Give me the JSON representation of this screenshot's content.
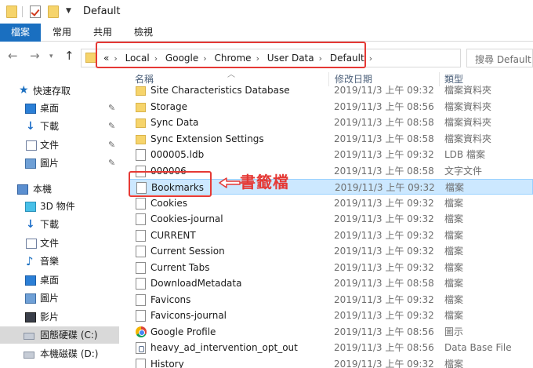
{
  "window": {
    "title": "Default"
  },
  "ribbon": {
    "tabs": [
      "檔案",
      "常用",
      "共用",
      "檢視"
    ]
  },
  "address": {
    "overflow": "«",
    "crumbs": [
      "Local",
      "Google",
      "Chrome",
      "User Data",
      "Default"
    ],
    "search_placeholder": "搜尋 Default"
  },
  "columns": {
    "name": "名稱",
    "date": "修改日期",
    "type": "類型"
  },
  "nav": {
    "quick_access": "快速存取",
    "quick_items": [
      "桌面",
      "下載",
      "文件",
      "圖片"
    ],
    "this_pc": "本機",
    "pc_items": [
      "3D 物件",
      "下載",
      "文件",
      "音樂",
      "桌面",
      "圖片",
      "影片",
      "固態硬碟 (C:)",
      "本機磁碟 (D:)"
    ]
  },
  "files": [
    {
      "name": "Site Characteristics Database",
      "date": "2019/11/3 上午 09:32",
      "type": "檔案資料夾",
      "icon": "folder"
    },
    {
      "name": "Storage",
      "date": "2019/11/3 上午 08:56",
      "type": "檔案資料夾",
      "icon": "folder"
    },
    {
      "name": "Sync Data",
      "date": "2019/11/3 上午 08:58",
      "type": "檔案資料夾",
      "icon": "folder"
    },
    {
      "name": "Sync Extension Settings",
      "date": "2019/11/3 上午 08:58",
      "type": "檔案資料夾",
      "icon": "folder"
    },
    {
      "name": "000005.ldb",
      "date": "2019/11/3 上午 09:32",
      "type": "LDB 檔案",
      "icon": "file"
    },
    {
      "name": "000006",
      "date": "2019/11/3 上午 08:58",
      "type": "文字文件",
      "icon": "file"
    },
    {
      "name": "Bookmarks",
      "date": "2019/11/3 上午 09:32",
      "type": "檔案",
      "icon": "file",
      "selected": true
    },
    {
      "name": "Cookies",
      "date": "2019/11/3 上午 09:32",
      "type": "檔案",
      "icon": "file"
    },
    {
      "name": "Cookies-journal",
      "date": "2019/11/3 上午 09:32",
      "type": "檔案",
      "icon": "file"
    },
    {
      "name": "CURRENT",
      "date": "2019/11/3 上午 09:32",
      "type": "檔案",
      "icon": "file"
    },
    {
      "name": "Current Session",
      "date": "2019/11/3 上午 09:32",
      "type": "檔案",
      "icon": "file"
    },
    {
      "name": "Current Tabs",
      "date": "2019/11/3 上午 09:32",
      "type": "檔案",
      "icon": "file"
    },
    {
      "name": "DownloadMetadata",
      "date": "2019/11/3 上午 08:58",
      "type": "檔案",
      "icon": "file"
    },
    {
      "name": "Favicons",
      "date": "2019/11/3 上午 09:32",
      "type": "檔案",
      "icon": "file"
    },
    {
      "name": "Favicons-journal",
      "date": "2019/11/3 上午 09:32",
      "type": "檔案",
      "icon": "file"
    },
    {
      "name": "Google Profile",
      "date": "2019/11/3 上午 08:56",
      "type": "圖示",
      "icon": "chrome"
    },
    {
      "name": "heavy_ad_intervention_opt_out",
      "date": "2019/11/3 上午 08:56",
      "type": "Data Base File",
      "icon": "db"
    },
    {
      "name": "History",
      "date": "2019/11/3 上午 09:32",
      "type": "檔案",
      "icon": "file"
    }
  ],
  "annotation": {
    "label": "書籤檔"
  },
  "colors": {
    "accent": "#1a6fc0",
    "highlight": "#e53935",
    "selection": "#cce8ff"
  }
}
